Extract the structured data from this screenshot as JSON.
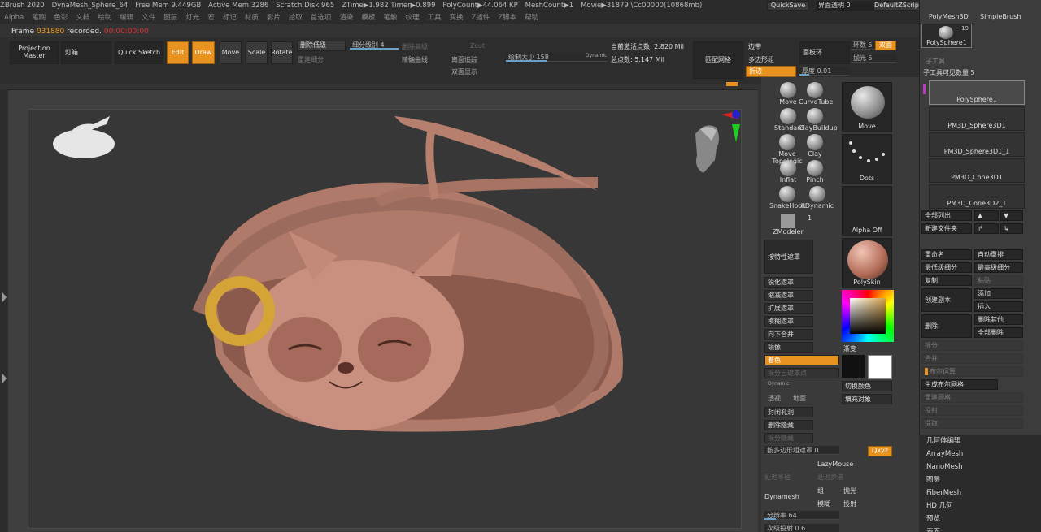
{
  "titlebar": {
    "app": "ZBrush 2020",
    "doc": "DynaMesh_Sphere_64",
    "free_mem": "Free Mem 9.449GB",
    "active_mem": "Active Mem 3286",
    "scratch": "Scratch Disk 965",
    "ztime": "ZTime▶1.982 Timer▶0.899",
    "polycount": "PolyCount▶44.064 KP",
    "meshcount": "MeshCount▶1",
    "movie": "Movie▶31879 \\Cc00000(10868mb)",
    "quicksave": "QuickSave",
    "transparency": "界面透明 0",
    "default_script": "DefaultZScript"
  },
  "menu": [
    "Alpha",
    "笔刷",
    "色彩",
    "文档",
    "绘制",
    "编辑",
    "文件",
    "图层",
    "灯光",
    "宏",
    "标记",
    "材质",
    "影片",
    "拾取",
    "首选项",
    "渲染",
    "模板",
    "笔触",
    "纹理",
    "工具",
    "变换",
    "Z插件",
    "Z脚本",
    "帮助"
  ],
  "frame_note": {
    "prefix": "Frame ",
    "frame": "031880",
    "mid": " recorded. ",
    "extra": "00:00:00:00"
  },
  "toolbar": {
    "projection_master": "Projection Master",
    "lightbox": "灯箱",
    "quick_sketch": "Quick Sketch",
    "edit": "Edit",
    "draw": "Draw",
    "move": "Move",
    "scale": "Scale",
    "rotate": "Rotate",
    "del_lower": "删除低级",
    "subdiv": "细分级别 4",
    "del_higher": "删除高级",
    "reconstruct": "重建细分",
    "smooth_curve": "精确曲线",
    "zcut": "Zcut",
    "stroke_tool": "离面追踪",
    "double_sided": "双面显示",
    "brush_size": "绘制大小 158",
    "dynamic": "Dynamic",
    "active_points": "当前激活点数: 2.820 Mil",
    "total_points": "总点数: 5.147 Mil",
    "match_mesh": "匹配网格",
    "edge": "边带",
    "polygroup": "多边形组",
    "crease": "折边",
    "loops": "面板环",
    "thickness": "厚度 0.01",
    "rings": "环数 5",
    "polish": "抛光 5",
    "double": "双面"
  },
  "brushes": [
    {
      "name": "Move",
      "name2": "CurveTube"
    },
    {
      "name": "Standard",
      "name2": "ClayBuildup"
    },
    {
      "name": "Move Topologic",
      "name2": "Clay"
    },
    {
      "name": "Inflat",
      "name2": "Pinch"
    },
    {
      "name": "SnakeHook",
      "name2": "hDynamic"
    },
    {
      "name": "ZModeler",
      "name2": "1"
    }
  ],
  "tiles": {
    "move": "Move",
    "dots": "Dots",
    "alpha": "Alpha Off",
    "material": "PolySkin"
  },
  "side_buttons": {
    "mask_by": "按特性遮罩",
    "sharpen_mask": "锐化遮罩",
    "shrink_mask": "缩减遮罩",
    "grow_mask": "扩展遮罩",
    "blur_mask": "模糊遮罩",
    "merge_down": "向下合并",
    "mirror": "镜像",
    "color": "着色",
    "paint_hidden": "拆分已遮罩点",
    "gradient": "渐变",
    "switch_color": "切换颜色",
    "fill_object": "填充对象",
    "close_holes": "封闭孔洞",
    "del_hidden": "删除隐藏",
    "split_hidden": "拆分隐藏",
    "group_by_poly": "按多边形组遮罩 0",
    "lazymouse": "LazyMouse",
    "lazy_radius": "延迟半径",
    "lazy_step": "延迟步进",
    "dynamesh": "Dynamesh",
    "group": "组",
    "polish": "抛光",
    "blur": "模糊",
    "project": "投射",
    "resolution": "分辨率 64",
    "sub_projection": "次级投射 0.6",
    "xyz": "Qxyz",
    "dynamic_label": "Dynamic",
    "persp": "透视",
    "floor": "地面"
  },
  "tool_panel": {
    "polymesh3d": "PolyMesh3D",
    "simplebrush": "SimpleBrush",
    "polysphere_thumb": "PolySphere1",
    "thumb_count": "19",
    "subtool_title": "子工具",
    "visible_count": "子工具可见数量 5",
    "subtools": [
      "PolySphere1",
      "PM3D_Sphere3D1",
      "PM3D_Sphere3D1_1",
      "PM3D_Cone3D1",
      "PM3D_Cone3D2_1"
    ],
    "list_all": "全部列出",
    "new_folder": "新建文件夹",
    "rename": "重命名",
    "auto_reorder": "自动重排",
    "lowest_sub": "最低级细分",
    "highest_sub": "最高级细分",
    "copy": "复制",
    "paste": "粘贴",
    "duplicate": "创建副本",
    "add": "添加",
    "insert": "插入",
    "delete": "删除",
    "del_other": "删除其他",
    "del_all": "全部删除",
    "split": "拆分",
    "merge": "合并",
    "boolean": "布尔运算",
    "make_boolean": "生成布尔网格",
    "remesh": "重建网格",
    "project": "投射",
    "extract": "提取"
  },
  "right_list": [
    "几何体编辑",
    "ArrayMesh",
    "NanoMesh",
    "图层",
    "FiberMesh",
    "HD 几何",
    "预览",
    "表面"
  ]
}
